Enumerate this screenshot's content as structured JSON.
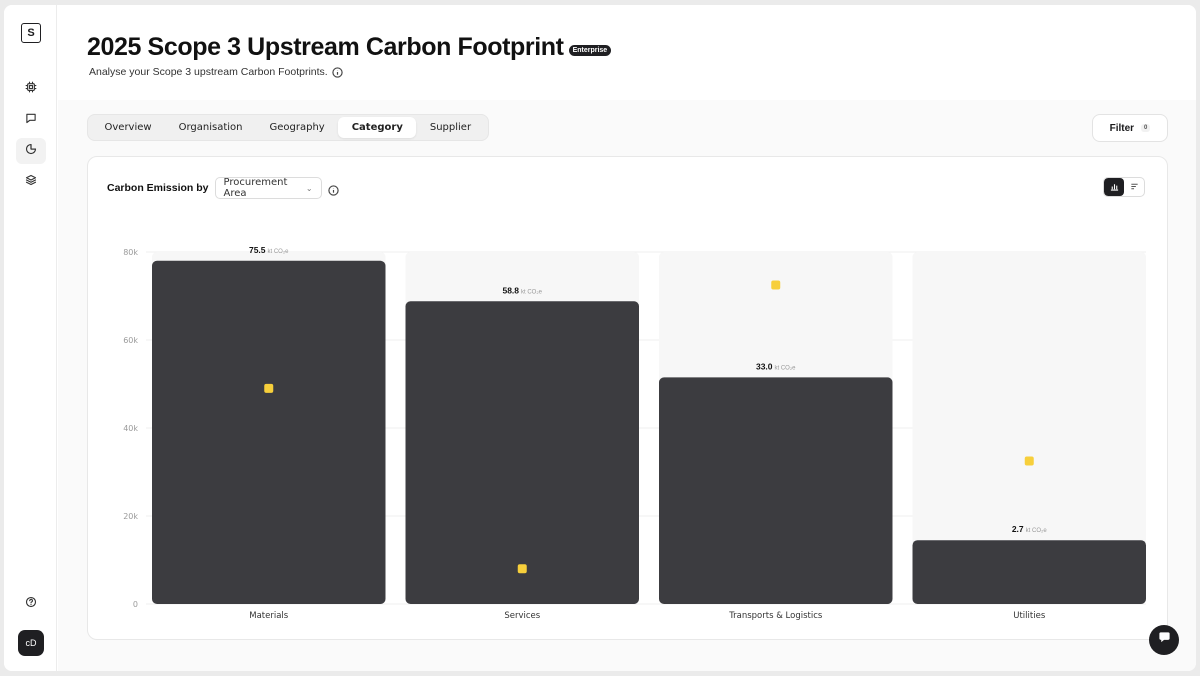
{
  "app": {
    "logo_letter": "S",
    "user_initials": "cD"
  },
  "rail": [
    {
      "icon": "chip-icon"
    },
    {
      "icon": "message-icon"
    },
    {
      "icon": "pie-chart-icon",
      "active": true
    },
    {
      "icon": "layers-icon"
    }
  ],
  "header": {
    "title": "2025 Scope 3 Upstream Carbon Footprint",
    "badge": "Enterprise",
    "subtitle": "Analyse your Scope 3 upstream Carbon Footprints."
  },
  "tabs": [
    {
      "label": "Overview",
      "active": false
    },
    {
      "label": "Organisation",
      "active": false
    },
    {
      "label": "Geography",
      "active": false
    },
    {
      "label": "Category",
      "active": true
    },
    {
      "label": "Supplier",
      "active": false
    }
  ],
  "filter": {
    "label": "Filter",
    "count": "0"
  },
  "card": {
    "label": "Carbon Emission by",
    "select_value": "Procurement Area"
  },
  "colors": {
    "bar": "#3c3c40",
    "track": "#f7f7f7",
    "marker": "#f7cf3b",
    "accent": "#1f1f22"
  },
  "chart_data": {
    "type": "bar",
    "categories": [
      "Materials",
      "Services",
      "Transports & Logistics",
      "Utilities"
    ],
    "values": [
      78000,
      68800,
      51500,
      14500
    ],
    "data_labels": [
      "75.5",
      "58.8",
      "33.0",
      "2.7"
    ],
    "unit_label": "kt CO₂e",
    "markers": [
      49000,
      8000,
      72500,
      32500
    ],
    "ylim": [
      0,
      80000
    ],
    "yticks": [
      0,
      20000,
      40000,
      60000,
      80000
    ],
    "ytick_labels": [
      "0",
      "20k",
      "40k",
      "60k",
      "80k"
    ],
    "grid": true
  }
}
